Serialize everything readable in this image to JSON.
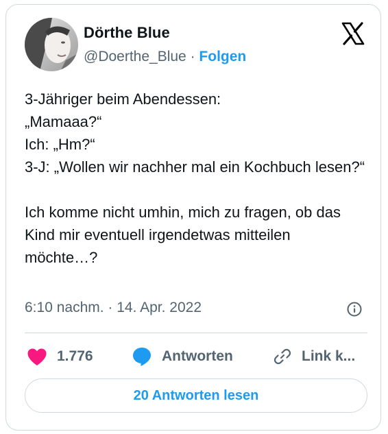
{
  "author": {
    "display_name": "Dörthe Blue",
    "handle": "@Doerthe_Blue",
    "separator": " · ",
    "follow_label": "Folgen"
  },
  "tweet": {
    "text": "3-Jähriger beim Abendessen:\n„Mamaaa?“\nIch: „Hm?“\n3-J: „Wollen wir nachher mal ein Kochbuch lesen?“\n\nIch komme nicht umhin, mich zu fragen, ob das Kind mir eventuell  irgendetwas mitteilen möchte…?",
    "timestamp": "6:10 nachm. · 14. Apr. 2022"
  },
  "actions": {
    "like_count": "1.776",
    "reply_label": "Antworten",
    "copy_link_label": "Link k..."
  },
  "footer": {
    "read_replies_label": "20 Antworten lesen"
  },
  "icons": {
    "brand": "x-logo-icon",
    "info": "info-icon",
    "like": "heart-icon",
    "reply": "speech-bubble-icon",
    "copy": "link-icon"
  },
  "colors": {
    "accent": "#1d9bf0",
    "like": "#f91880",
    "muted": "#536471",
    "border": "#cfd9de"
  }
}
